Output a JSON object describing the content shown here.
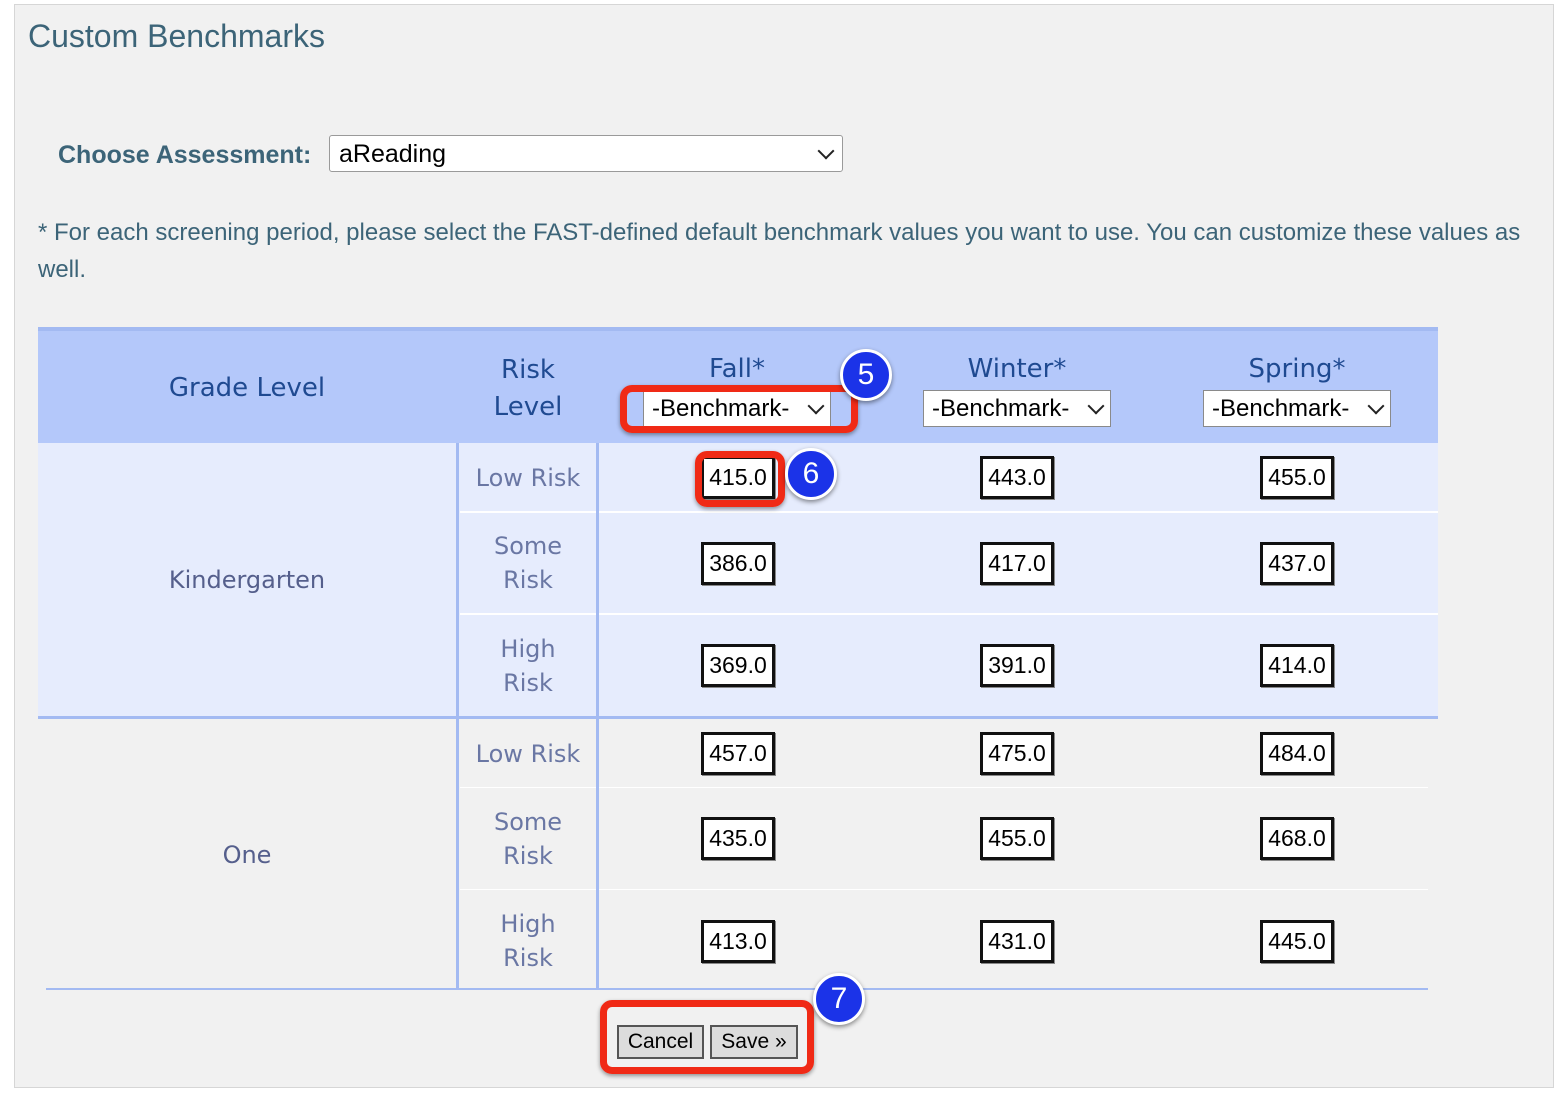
{
  "title": "Custom Benchmarks",
  "assessment": {
    "label": "Choose Assessment:",
    "selected": "aReading"
  },
  "note": "* For each screening period, please select the FAST-defined default benchmark values you want to use. You can customize these values as well.",
  "table": {
    "headers": {
      "grade_level": "Grade Level",
      "risk_level": [
        "Risk",
        "Level"
      ],
      "fall": "Fall*",
      "winter": "Winter*",
      "spring": "Spring*"
    },
    "benchmark_select": {
      "fall": "-Benchmark-",
      "winter": "-Benchmark-",
      "spring": "-Benchmark-"
    },
    "grades": [
      {
        "name": "Kindergarten",
        "rows": [
          {
            "risk": [
              "Low Risk"
            ],
            "fall": "415.0",
            "winter": "443.0",
            "spring": "455.0"
          },
          {
            "risk": [
              "Some",
              "Risk"
            ],
            "fall": "386.0",
            "winter": "417.0",
            "spring": "437.0"
          },
          {
            "risk": [
              "High",
              "Risk"
            ],
            "fall": "369.0",
            "winter": "391.0",
            "spring": "414.0"
          }
        ]
      },
      {
        "name": "One",
        "rows": [
          {
            "risk": [
              "Low Risk"
            ],
            "fall": "457.0",
            "winter": "475.0",
            "spring": "484.0"
          },
          {
            "risk": [
              "Some",
              "Risk"
            ],
            "fall": "435.0",
            "winter": "455.0",
            "spring": "468.0"
          },
          {
            "risk": [
              "High",
              "Risk"
            ],
            "fall": "413.0",
            "winter": "431.0",
            "spring": "445.0"
          }
        ]
      }
    ]
  },
  "buttons": {
    "cancel": "Cancel",
    "save": "Save »"
  },
  "callouts": {
    "a": "5",
    "b": "6",
    "c": "7"
  },
  "colors": {
    "header_bg": "#b4c8fa",
    "band_bg": "#e6ecfd",
    "annotation_red": "#f02a16",
    "badge_blue": "#1b33e8"
  }
}
